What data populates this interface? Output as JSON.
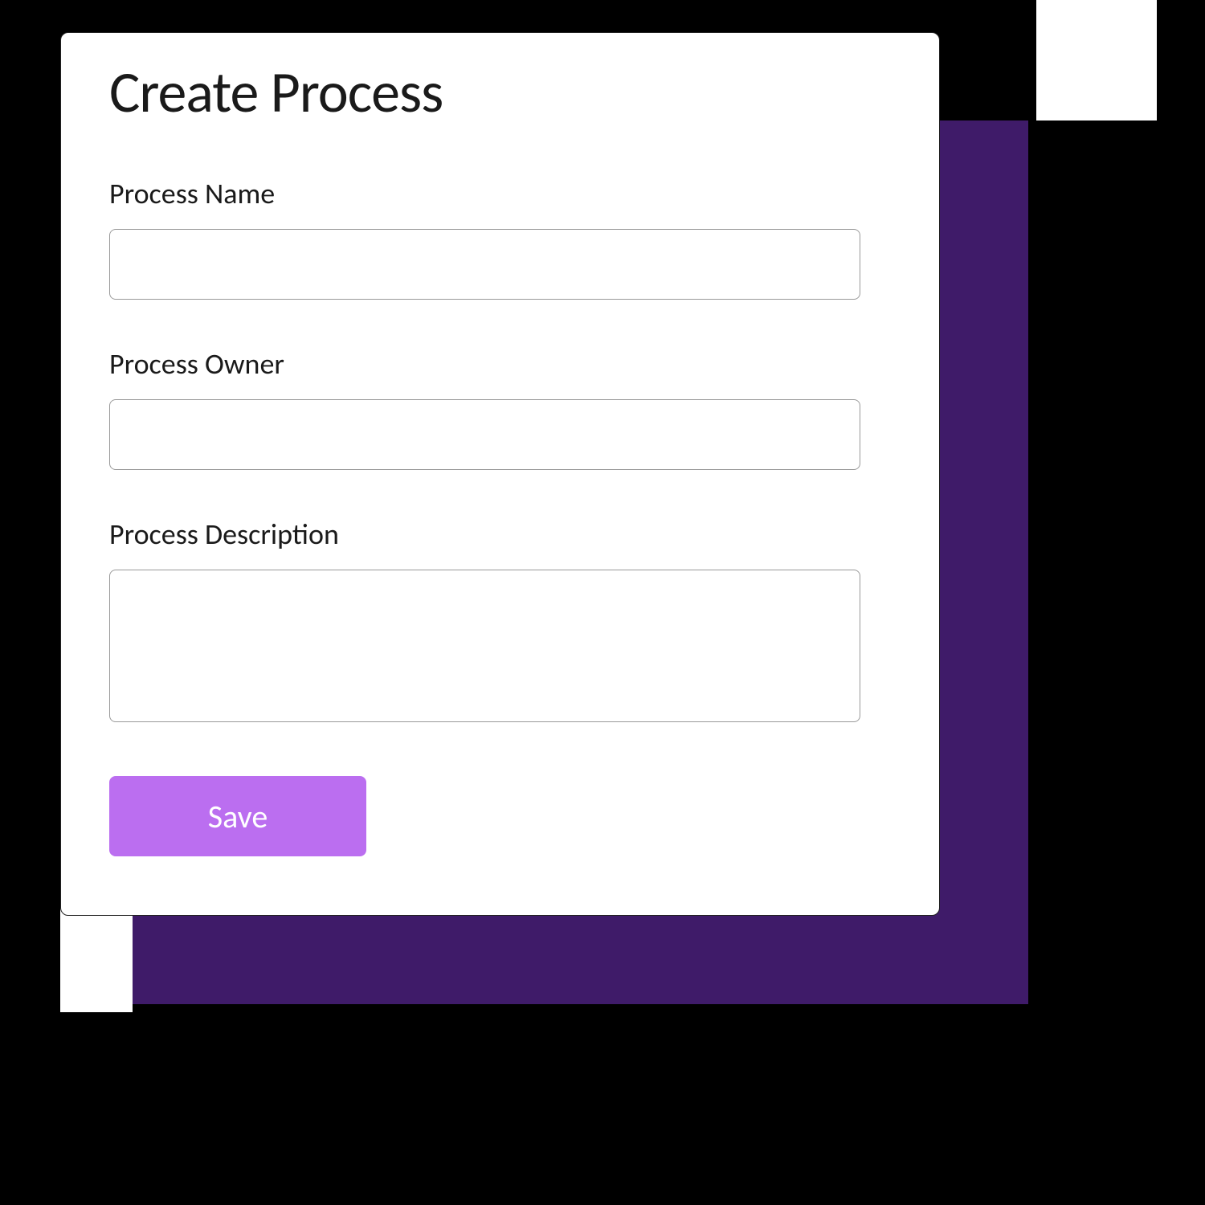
{
  "modal": {
    "title": "Create Process",
    "fields": {
      "name": {
        "label": "Process Name",
        "value": ""
      },
      "owner": {
        "label": "Process Owner",
        "value": ""
      },
      "description": {
        "label": "Process Description",
        "value": ""
      }
    },
    "save_label": "Save"
  },
  "colors": {
    "accent_purple": "#3f1b69",
    "button_purple": "#bb6ef0"
  }
}
